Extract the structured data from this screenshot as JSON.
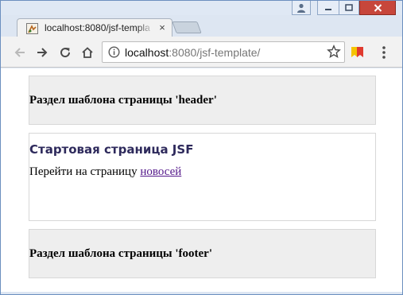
{
  "browser": {
    "tab": {
      "title": "localhost:8080/jsf-templa",
      "close_glyph": "×"
    },
    "address_bar": {
      "host": "localhost",
      "rest": ":8080/jsf-template/"
    },
    "icons": {
      "back": "back-arrow-icon",
      "forward": "forward-arrow-icon",
      "reload": "reload-icon",
      "home": "home-icon",
      "info": "info-icon",
      "star": "star-icon",
      "menu": "kebab-menu-icon"
    },
    "colors": {
      "frame": "#6b8fbf",
      "close_button": "#c7463b"
    }
  },
  "page": {
    "header_text": "Раздел шаблона страницы 'header'",
    "content": {
      "title": "Стартовая страница JSF",
      "goto_text": "Перейти на страницу ",
      "link_text": "новосей"
    },
    "footer_text": "Раздел шаблона страницы 'footer'",
    "colors": {
      "title": "#2e2a5c",
      "link": "#551a8b",
      "box_gray": "#eeeeee"
    }
  }
}
